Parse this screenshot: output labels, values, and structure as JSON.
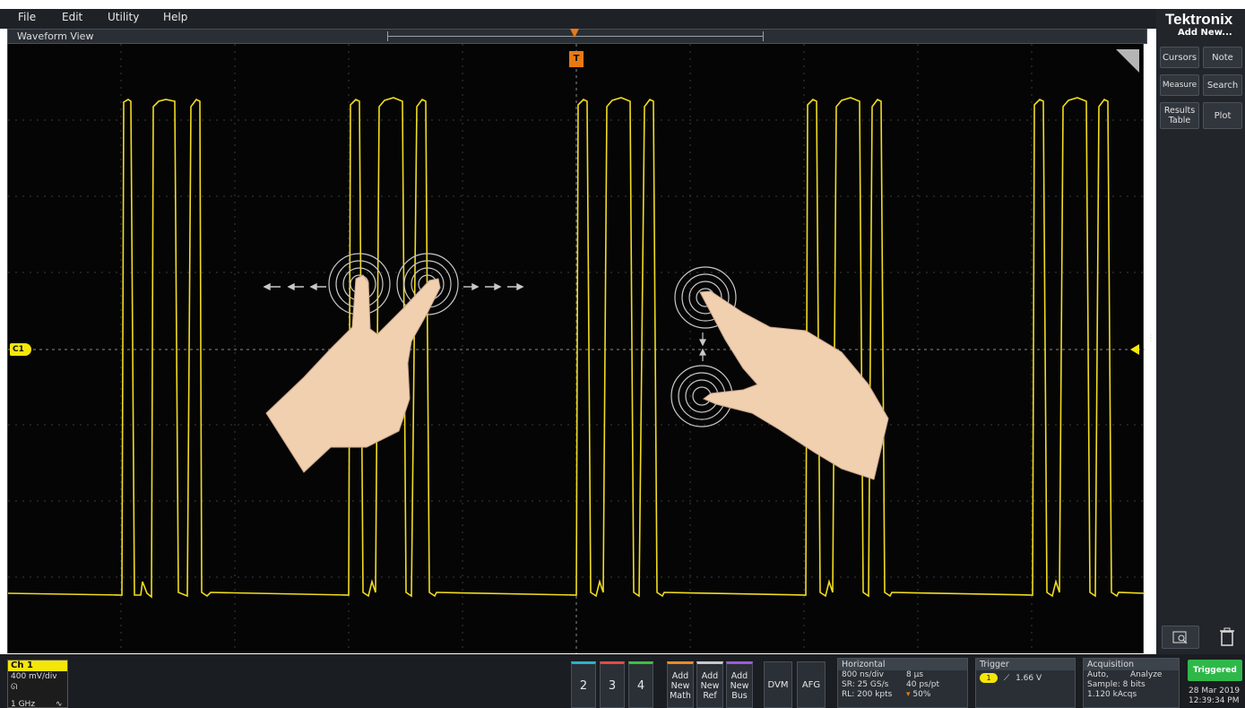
{
  "menu": [
    "File",
    "Edit",
    "Utility",
    "Help"
  ],
  "brand": "Tektronix",
  "waveform_view": {
    "title": "Waveform View",
    "channel_marker": "C1",
    "trigger_marker": "T"
  },
  "right_panel": {
    "add_new": "Add New...",
    "buttons": [
      "Cursors",
      "Note",
      "Measure",
      "Search",
      "Results Table",
      "Plot"
    ]
  },
  "ch1": {
    "label": "Ch 1",
    "scale": "400 mV/div",
    "bandwidth": "1 GHz",
    "color": "#f5e60a"
  },
  "channel_buttons": [
    "2",
    "3",
    "4"
  ],
  "add_buttons": [
    {
      "l1": "Add",
      "l2": "New",
      "l3": "Math"
    },
    {
      "l1": "Add",
      "l2": "New",
      "l3": "Ref"
    },
    {
      "l1": "Add",
      "l2": "New",
      "l3": "Bus"
    }
  ],
  "tool_buttons": [
    "DVM",
    "AFG"
  ],
  "horizontal": {
    "title": "Horizontal",
    "scale": "800 ns/div",
    "duration": "8 µs",
    "sample_rate": "SR: 25 GS/s",
    "resolution": "40 ps/pt",
    "record_length": "RL: 200 kpts",
    "position": "50%"
  },
  "trigger": {
    "title": "Trigger",
    "source": "1",
    "level": "1.66 V"
  },
  "acquisition": {
    "title": "Acquisition",
    "mode": "Auto,",
    "analyze": "Analyze",
    "sample": "Sample: 8 bits",
    "acqs": "1.120 kAcqs"
  },
  "status": {
    "label": "Triggered",
    "date": "28 Mar 2019",
    "time": "12:39:34 PM"
  }
}
